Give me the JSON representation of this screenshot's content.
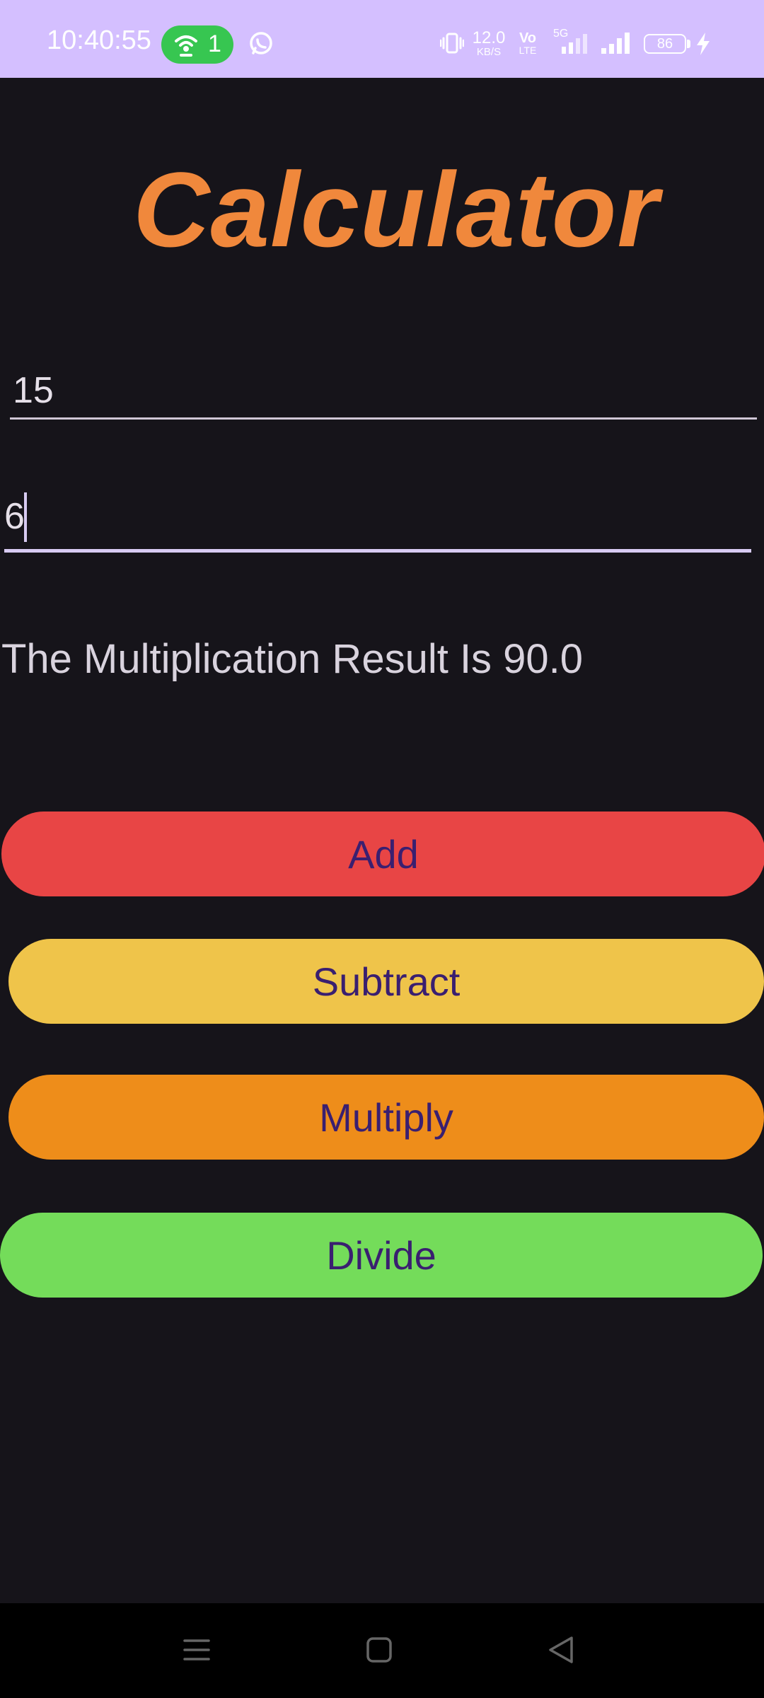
{
  "status_bar": {
    "time": "10:40:55",
    "hotspot_count": "1",
    "net_speed_value": "12.0",
    "net_speed_unit": "KB/S",
    "volte_top": "Vo",
    "volte_bottom": "LTE",
    "network_type": "5G",
    "battery_level": "86",
    "icons": {
      "hotspot": "hotspot-icon",
      "whatsapp": "whatsapp-icon",
      "vibrate": "vibrate-icon",
      "signal": "signal-icon",
      "charging": "charging-bolt-icon"
    }
  },
  "app": {
    "title": "Calculator"
  },
  "inputs": {
    "first_number": "15",
    "second_number": "6"
  },
  "result": {
    "text": "The Multiplication Result Is 90.0"
  },
  "buttons": {
    "add": "Add",
    "subtract": "Subtract",
    "multiply": "Multiply",
    "divide": "Divide"
  },
  "colors": {
    "status_bar_bg": "#d4bfff",
    "background": "#16141a",
    "title": "#f0883c",
    "add_button": "#e84545",
    "subtract_button": "#efc44a",
    "multiply_button": "#ee8d1a",
    "divide_button": "#74dc5a",
    "button_text": "#3a1f70"
  },
  "nav_bar": {
    "icons": [
      "menu-icon",
      "home-icon",
      "back-icon"
    ]
  }
}
